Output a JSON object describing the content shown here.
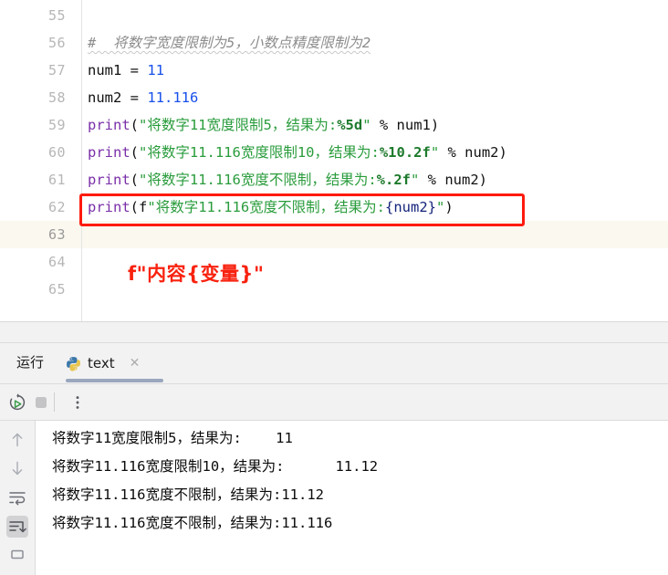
{
  "editor": {
    "lines": [
      {
        "number": "55",
        "tokens": []
      },
      {
        "number": "56",
        "tokens": [
          {
            "cls": "t-cmt",
            "text": "#  将数字宽度限制为5，小数点精度限制为2"
          }
        ]
      },
      {
        "number": "57",
        "tokens": [
          {
            "cls": "t-plain",
            "text": "num1 "
          },
          {
            "cls": "t-op",
            "text": "= "
          },
          {
            "cls": "t-num",
            "text": "11"
          }
        ]
      },
      {
        "number": "58",
        "tokens": [
          {
            "cls": "t-plain",
            "text": "num2 "
          },
          {
            "cls": "t-op",
            "text": "= "
          },
          {
            "cls": "t-num",
            "text": "11.116"
          }
        ]
      },
      {
        "number": "59",
        "tokens": [
          {
            "cls": "t-fn",
            "text": "print"
          },
          {
            "cls": "t-paren",
            "text": "("
          },
          {
            "cls": "t-quote",
            "text": "\"将数字11宽度限制5，结果为:"
          },
          {
            "cls": "t-strfmt",
            "text": "%5d"
          },
          {
            "cls": "t-quote",
            "text": "\""
          },
          {
            "cls": "t-plain",
            "text": " % num1"
          },
          {
            "cls": "t-paren",
            "text": ")"
          }
        ]
      },
      {
        "number": "60",
        "tokens": [
          {
            "cls": "t-fn",
            "text": "print"
          },
          {
            "cls": "t-paren",
            "text": "("
          },
          {
            "cls": "t-quote",
            "text": "\"将数字11.116宽度限制10，结果为:"
          },
          {
            "cls": "t-strfmt",
            "text": "%10.2f"
          },
          {
            "cls": "t-quote",
            "text": "\""
          },
          {
            "cls": "t-plain",
            "text": " % num2"
          },
          {
            "cls": "t-paren",
            "text": ")"
          }
        ]
      },
      {
        "number": "61",
        "tokens": [
          {
            "cls": "t-fn",
            "text": "print"
          },
          {
            "cls": "t-paren",
            "text": "("
          },
          {
            "cls": "t-quote",
            "text": "\"将数字11.116宽度不限制，结果为:"
          },
          {
            "cls": "t-strfmt",
            "text": "%.2f"
          },
          {
            "cls": "t-quote",
            "text": "\""
          },
          {
            "cls": "t-plain",
            "text": " % num2"
          },
          {
            "cls": "t-paren",
            "text": ")"
          }
        ]
      },
      {
        "number": "62",
        "tokens": [
          {
            "cls": "t-fn",
            "text": "print"
          },
          {
            "cls": "t-paren",
            "text": "("
          },
          {
            "cls": "t-plain",
            "text": "f"
          },
          {
            "cls": "t-quote",
            "text": "\"将数字11.116宽度不限制，结果为:"
          },
          {
            "cls": "t-fexpr",
            "text": "{num2}"
          },
          {
            "cls": "t-quote",
            "text": "\""
          },
          {
            "cls": "t-paren",
            "text": ")"
          }
        ]
      },
      {
        "number": "63",
        "tokens": [],
        "current": true
      },
      {
        "number": "64",
        "tokens": []
      },
      {
        "number": "65",
        "tokens": []
      }
    ],
    "annotation": {
      "text": "f\"内容{变量}\"",
      "color": "#f8220f",
      "highlight_line": "62"
    }
  },
  "run_panel": {
    "title": "运行",
    "tab": {
      "label": "text",
      "icon": "python-icon",
      "close_label": "✕"
    },
    "toolbar": {
      "rerun_label": "rerun-icon",
      "stop_label": "stop-icon",
      "more_label": "more-options-icon"
    },
    "rail": [
      {
        "name": "scroll-up-icon"
      },
      {
        "name": "scroll-down-icon"
      },
      {
        "name": "soft-wrap-icon"
      },
      {
        "name": "scroll-to-end-icon",
        "selected": true
      },
      {
        "name": "print-icon"
      }
    ],
    "console_lines": [
      "将数字11宽度限制5，结果为:    11",
      "将数字11.116宽度限制10，结果为:      11.12",
      "将数字11.116宽度不限制，结果为:11.12",
      "将数字11.116宽度不限制，结果为:11.116"
    ]
  },
  "colors": {
    "accent": "#9aa7bd",
    "annotation_red": "#f8220f",
    "current_line": "#fbf8ef",
    "string_green": "#2a9c3c",
    "number_blue": "#1750eb",
    "function_purple": "#7a2fa8"
  }
}
